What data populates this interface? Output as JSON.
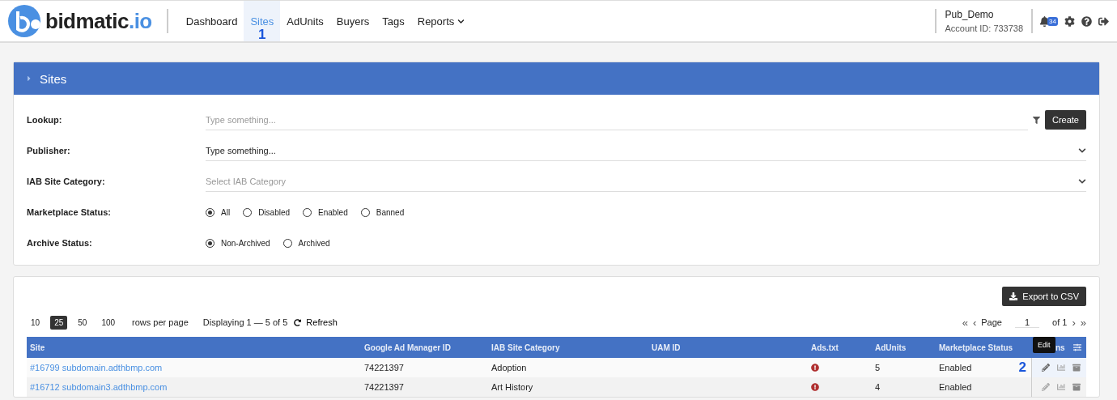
{
  "brand": {
    "name": "bidmatic",
    "suffix": ".io"
  },
  "nav": [
    {
      "label": "Dashboard",
      "selected": false,
      "dropdown": false
    },
    {
      "label": "Sites",
      "selected": true,
      "dropdown": false,
      "annotation": "1"
    },
    {
      "label": "AdUnits",
      "selected": false,
      "dropdown": false
    },
    {
      "label": "Buyers",
      "selected": false,
      "dropdown": false
    },
    {
      "label": "Tags",
      "selected": false,
      "dropdown": false
    },
    {
      "label": "Reports",
      "selected": false,
      "dropdown": true
    }
  ],
  "account": {
    "name": "Pub_Demo",
    "id": "Account ID: 733738",
    "notifications": "34"
  },
  "panel": {
    "title": "Sites",
    "expanded": false
  },
  "filters": [
    {
      "kind": "text",
      "label": "Lookup:",
      "placeholder": "Type something...",
      "button": "Create"
    },
    {
      "kind": "select",
      "label": "Publisher:",
      "value": "Type something..."
    },
    {
      "kind": "select",
      "label": "IAB Site Category:",
      "placeholder": "Select IAB Category"
    },
    {
      "kind": "radio",
      "label": "Marketplace Status:",
      "options": [
        {
          "label": "All",
          "selected": true
        },
        {
          "label": "Disabled",
          "selected": false
        },
        {
          "label": "Enabled",
          "selected": false
        },
        {
          "label": "Banned",
          "selected": false
        }
      ]
    },
    {
      "kind": "radio",
      "label": "Archive Status:",
      "options": [
        {
          "label": "Non-Archived",
          "selected": true
        },
        {
          "label": "Archived",
          "selected": false
        }
      ]
    }
  ],
  "export_button": "Export to CSV",
  "page_sizes": [
    {
      "label": "10",
      "selected": false
    },
    {
      "label": "25",
      "selected": true
    },
    {
      "label": "50",
      "selected": false
    },
    {
      "label": "100",
      "selected": false
    }
  ],
  "rows_per_page": "rows per page",
  "displaying": "Displaying 1 — 5 of 5",
  "refresh": "Refresh",
  "pagination": {
    "first": "«",
    "prev": "‹",
    "page_label": "Page",
    "page": "1",
    "of": "of 1",
    "next": "›",
    "last": "»"
  },
  "table": {
    "columns": [
      "Site",
      "Google Ad Manager ID",
      "IAB Site Category",
      "UAM ID",
      "Ads.txt",
      "AdUnits",
      "Marketplace Status",
      "ns"
    ],
    "tooltip": "Edit",
    "annotation": "2",
    "rows": [
      {
        "site": "#16799 subdomain.adthbmp.com",
        "gam": "74221397",
        "category": "Adoption",
        "uam": "",
        "ads_warning": true,
        "adunits": "5",
        "status": "Enabled",
        "hovered": true
      },
      {
        "site": "#16712 subdomain3.adthbmp.com",
        "gam": "74221397",
        "category": "Art History",
        "uam": "",
        "ads_warning": true,
        "adunits": "4",
        "status": "Enabled",
        "hovered": false
      }
    ]
  }
}
